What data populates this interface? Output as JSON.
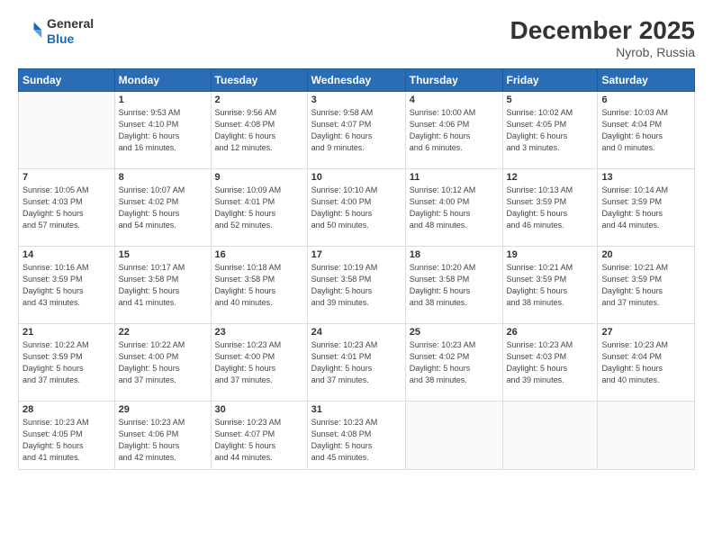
{
  "header": {
    "logo_general": "General",
    "logo_blue": "Blue",
    "month_title": "December 2025",
    "location": "Nyrob, Russia"
  },
  "weekdays": [
    "Sunday",
    "Monday",
    "Tuesday",
    "Wednesday",
    "Thursday",
    "Friday",
    "Saturday"
  ],
  "weeks": [
    [
      {
        "day": "",
        "info": ""
      },
      {
        "day": "1",
        "info": "Sunrise: 9:53 AM\nSunset: 4:10 PM\nDaylight: 6 hours\nand 16 minutes."
      },
      {
        "day": "2",
        "info": "Sunrise: 9:56 AM\nSunset: 4:08 PM\nDaylight: 6 hours\nand 12 minutes."
      },
      {
        "day": "3",
        "info": "Sunrise: 9:58 AM\nSunset: 4:07 PM\nDaylight: 6 hours\nand 9 minutes."
      },
      {
        "day": "4",
        "info": "Sunrise: 10:00 AM\nSunset: 4:06 PM\nDaylight: 6 hours\nand 6 minutes."
      },
      {
        "day": "5",
        "info": "Sunrise: 10:02 AM\nSunset: 4:05 PM\nDaylight: 6 hours\nand 3 minutes."
      },
      {
        "day": "6",
        "info": "Sunrise: 10:03 AM\nSunset: 4:04 PM\nDaylight: 6 hours\nand 0 minutes."
      }
    ],
    [
      {
        "day": "7",
        "info": "Sunrise: 10:05 AM\nSunset: 4:03 PM\nDaylight: 5 hours\nand 57 minutes."
      },
      {
        "day": "8",
        "info": "Sunrise: 10:07 AM\nSunset: 4:02 PM\nDaylight: 5 hours\nand 54 minutes."
      },
      {
        "day": "9",
        "info": "Sunrise: 10:09 AM\nSunset: 4:01 PM\nDaylight: 5 hours\nand 52 minutes."
      },
      {
        "day": "10",
        "info": "Sunrise: 10:10 AM\nSunset: 4:00 PM\nDaylight: 5 hours\nand 50 minutes."
      },
      {
        "day": "11",
        "info": "Sunrise: 10:12 AM\nSunset: 4:00 PM\nDaylight: 5 hours\nand 48 minutes."
      },
      {
        "day": "12",
        "info": "Sunrise: 10:13 AM\nSunset: 3:59 PM\nDaylight: 5 hours\nand 46 minutes."
      },
      {
        "day": "13",
        "info": "Sunrise: 10:14 AM\nSunset: 3:59 PM\nDaylight: 5 hours\nand 44 minutes."
      }
    ],
    [
      {
        "day": "14",
        "info": "Sunrise: 10:16 AM\nSunset: 3:59 PM\nDaylight: 5 hours\nand 43 minutes."
      },
      {
        "day": "15",
        "info": "Sunrise: 10:17 AM\nSunset: 3:58 PM\nDaylight: 5 hours\nand 41 minutes."
      },
      {
        "day": "16",
        "info": "Sunrise: 10:18 AM\nSunset: 3:58 PM\nDaylight: 5 hours\nand 40 minutes."
      },
      {
        "day": "17",
        "info": "Sunrise: 10:19 AM\nSunset: 3:58 PM\nDaylight: 5 hours\nand 39 minutes."
      },
      {
        "day": "18",
        "info": "Sunrise: 10:20 AM\nSunset: 3:58 PM\nDaylight: 5 hours\nand 38 minutes."
      },
      {
        "day": "19",
        "info": "Sunrise: 10:21 AM\nSunset: 3:59 PM\nDaylight: 5 hours\nand 38 minutes."
      },
      {
        "day": "20",
        "info": "Sunrise: 10:21 AM\nSunset: 3:59 PM\nDaylight: 5 hours\nand 37 minutes."
      }
    ],
    [
      {
        "day": "21",
        "info": "Sunrise: 10:22 AM\nSunset: 3:59 PM\nDaylight: 5 hours\nand 37 minutes."
      },
      {
        "day": "22",
        "info": "Sunrise: 10:22 AM\nSunset: 4:00 PM\nDaylight: 5 hours\nand 37 minutes."
      },
      {
        "day": "23",
        "info": "Sunrise: 10:23 AM\nSunset: 4:00 PM\nDaylight: 5 hours\nand 37 minutes."
      },
      {
        "day": "24",
        "info": "Sunrise: 10:23 AM\nSunset: 4:01 PM\nDaylight: 5 hours\nand 37 minutes."
      },
      {
        "day": "25",
        "info": "Sunrise: 10:23 AM\nSunset: 4:02 PM\nDaylight: 5 hours\nand 38 minutes."
      },
      {
        "day": "26",
        "info": "Sunrise: 10:23 AM\nSunset: 4:03 PM\nDaylight: 5 hours\nand 39 minutes."
      },
      {
        "day": "27",
        "info": "Sunrise: 10:23 AM\nSunset: 4:04 PM\nDaylight: 5 hours\nand 40 minutes."
      }
    ],
    [
      {
        "day": "28",
        "info": "Sunrise: 10:23 AM\nSunset: 4:05 PM\nDaylight: 5 hours\nand 41 minutes."
      },
      {
        "day": "29",
        "info": "Sunrise: 10:23 AM\nSunset: 4:06 PM\nDaylight: 5 hours\nand 42 minutes."
      },
      {
        "day": "30",
        "info": "Sunrise: 10:23 AM\nSunset: 4:07 PM\nDaylight: 5 hours\nand 44 minutes."
      },
      {
        "day": "31",
        "info": "Sunrise: 10:23 AM\nSunset: 4:08 PM\nDaylight: 5 hours\nand 45 minutes."
      },
      {
        "day": "",
        "info": ""
      },
      {
        "day": "",
        "info": ""
      },
      {
        "day": "",
        "info": ""
      }
    ]
  ]
}
